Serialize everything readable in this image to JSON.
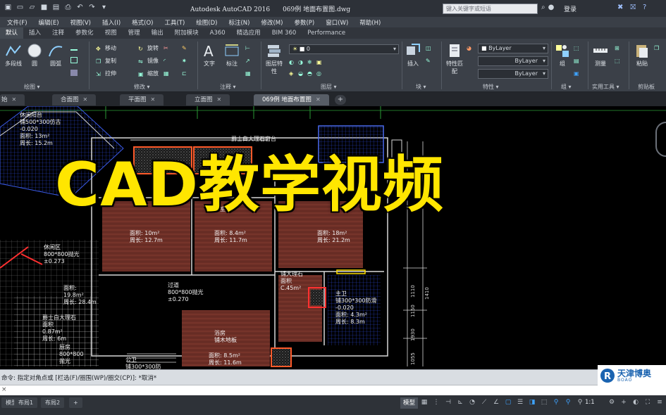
{
  "titlebar": {
    "app": "Autodesk AutoCAD 2016",
    "document": "069例 地面布置图.dwg",
    "search_placeholder": "键入关键字或短语",
    "login": "登录"
  },
  "menus": [
    "文件(F)",
    "编辑(E)",
    "视图(V)",
    "插入(I)",
    "格式(O)",
    "工具(T)",
    "绘图(D)",
    "标注(N)",
    "修改(M)",
    "参数(P)",
    "窗口(W)",
    "帮助(H)"
  ],
  "ribbon_tabs": [
    "默认",
    "插入",
    "注释",
    "参数化",
    "视图",
    "管理",
    "输出",
    "附加模块",
    "A360",
    "精选应用",
    "BIM 360",
    "Performance"
  ],
  "ribbon": {
    "draw": {
      "polyline": "多段线",
      "circle": "圆",
      "arc": "圆弧",
      "panel": "绘图 ▾"
    },
    "modify": {
      "move": "移动",
      "rotate": "旋转",
      "copy": "复制",
      "mirror": "镜像",
      "stretch": "拉伸",
      "scale": "缩放",
      "panel": "修改 ▾"
    },
    "annotation": {
      "text": "文字",
      "dimension": "标注",
      "panel": "注释 ▾"
    },
    "layers": {
      "properties": "图层特性",
      "current_layer": "0",
      "panel": "图层 ▾"
    },
    "block": {
      "insert": "插入",
      "panel": "块 ▾"
    },
    "properties": {
      "match": "特性匹配",
      "color": "ByLayer",
      "linetype": "ByLayer",
      "lineweight": "ByLayer",
      "panel": "特性 ▾"
    },
    "groups": {
      "group": "组",
      "panel": "组 ▾"
    },
    "utilities": {
      "measure": "测量",
      "panel": "实用工具 ▾"
    },
    "clipboard": {
      "paste": "粘贴",
      "panel": "剪贴板"
    }
  },
  "file_tabs": [
    "始",
    "合面图",
    "平面图",
    "立面图",
    "069例 地面布置图"
  ],
  "overlay": {
    "title": "CAD教学视频"
  },
  "labels": {
    "balcony": [
      "休闲阳台",
      "铺500*300仿古",
      "-0.020",
      "面积: 13m²",
      "周长: 15.2m"
    ],
    "counter": "爵士白大理石窗台",
    "room1": [
      "面积: 10m²",
      "周长: 12.7m"
    ],
    "room2": [
      "卧室",
      "面积: 8.4m²",
      "周长: 11.7m"
    ],
    "room3": [
      "面积: 18m²",
      "周长: 21.2m"
    ],
    "leisure": [
      "休闲区",
      "800*800抛光",
      "±0.273"
    ],
    "area_left": [
      "面积:",
      "19.8m²",
      "周长: 28.4m"
    ],
    "corridor": [
      "过道",
      "800*800抛光",
      "±0.270"
    ],
    "marble": [
      "铺大理石",
      "面积",
      "C.45m²"
    ],
    "wc": [
      "主卫",
      "铺300*300防滑",
      "-0.020",
      "面积: 4.3m²",
      "周长: 8.3m"
    ],
    "granite": [
      "爵士白大理石",
      "面积",
      "0.87m²",
      "周长: 6m"
    ],
    "kitchen": [
      "厨房",
      "800*800",
      "抛光"
    ],
    "bath": [
      "浴房",
      "铺木地板"
    ],
    "bath_area": [
      "面积: 8.5m²",
      "周长: 11.6m"
    ],
    "public_wc": [
      "公卫",
      "铺300*300防"
    ],
    "dims": [
      "1110",
      "1150",
      "1930",
      "1410",
      "1055"
    ]
  },
  "command": {
    "prompt": "命令: 指定对角点或 [栏选(F)/圈围(WP)/圈交(CP)]: *取消*",
    "input_mark": "×"
  },
  "logo": {
    "name": "天津博奥",
    "sub": "BOAO"
  },
  "statusbar": {
    "layout_tabs": [
      "模型",
      "布局1",
      "布局2"
    ],
    "model": "模型",
    "scale": "1:1"
  },
  "colors": {
    "overlay": "#ffe600",
    "ribbon": "#3b4048",
    "canvas": "#000000",
    "accent": "#3ea3ff"
  }
}
